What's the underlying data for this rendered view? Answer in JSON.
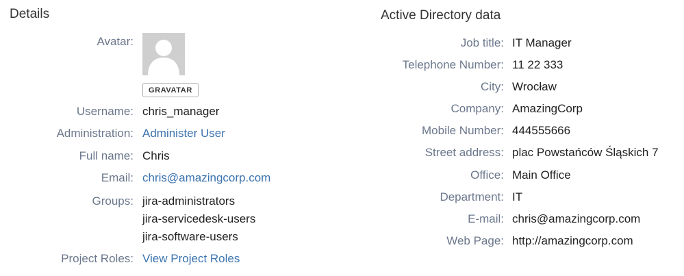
{
  "details": {
    "heading": "Details",
    "avatar_label": "Avatar:",
    "gravatar_button": "GRAVATAR",
    "username_label": "Username:",
    "username_value": "chris_manager",
    "administration_label": "Administration:",
    "administration_link": "Administer User",
    "fullname_label": "Full name:",
    "fullname_value": "Chris",
    "email_label": "Email:",
    "email_value": "chris@amazingcorp.com",
    "groups_label": "Groups:",
    "groups": [
      "jira-administrators",
      "jira-servicedesk-users",
      "jira-software-users"
    ],
    "project_roles_label": "Project Roles:",
    "project_roles_link": "View Project Roles"
  },
  "ad": {
    "heading": "Active Directory data",
    "rows": [
      {
        "label": "Job title:",
        "value": "IT Manager"
      },
      {
        "label": "Telephone Number:",
        "value": "11 22 333"
      },
      {
        "label": "City:",
        "value": "Wrocław"
      },
      {
        "label": "Company:",
        "value": "AmazingCorp"
      },
      {
        "label": "Mobile Number:",
        "value": "444555666"
      },
      {
        "label": "Street address:",
        "value": "plac Powstańców Śląskich 7"
      },
      {
        "label": "Office:",
        "value": "Main Office"
      },
      {
        "label": "Department:",
        "value": "IT"
      },
      {
        "label": "E-mail:",
        "value": "chris@amazingcorp.com"
      },
      {
        "label": "Web Page:",
        "value": "http://amazingcorp.com"
      }
    ]
  },
  "colors": {
    "label": "#6b778c",
    "link": "#3b73af",
    "value": "#222222",
    "avatar_bg": "#cfcfcf"
  },
  "icons": {
    "avatar": "default-user-silhouette"
  }
}
